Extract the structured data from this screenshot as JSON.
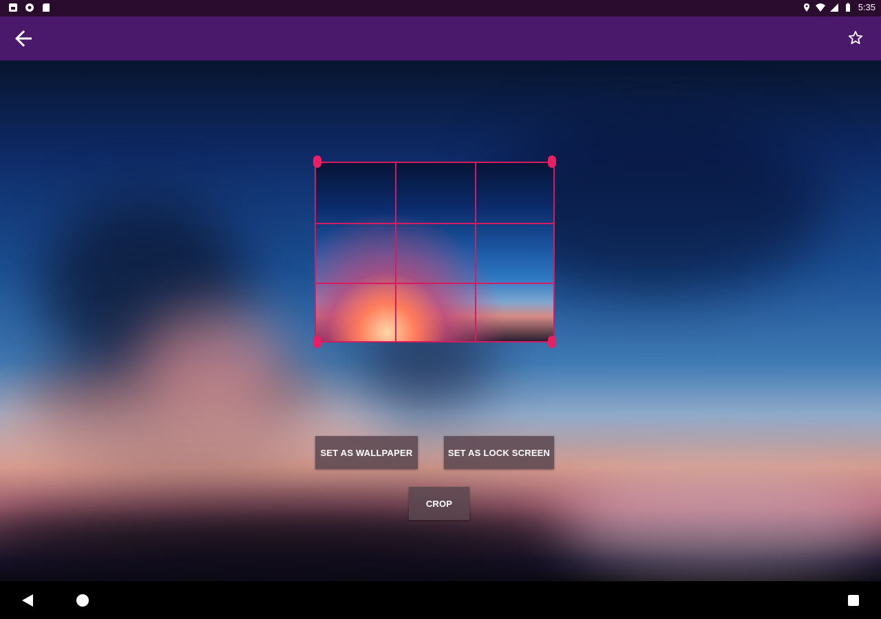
{
  "status_bar": {
    "time": "5:35",
    "left_icons": [
      "android-icon",
      "settings-icon",
      "sd-card-icon"
    ],
    "right_icons": [
      "location-icon",
      "wifi-icon",
      "signal-icon",
      "battery-icon"
    ]
  },
  "app_bar": {
    "back_icon": "arrow-back-icon",
    "favorite_icon": "star-outline-icon",
    "color": "#4a196b"
  },
  "actions": {
    "set_wallpaper": "SET AS WALLPAPER",
    "set_lock_screen": "SET AS LOCK SCREEN",
    "crop": "CROP"
  },
  "crop_overlay": {
    "accent_color": "#e91e63"
  },
  "nav_bar": {
    "back_icon": "nav-back-icon",
    "home_icon": "nav-home-icon",
    "recents_icon": "nav-recents-icon"
  }
}
